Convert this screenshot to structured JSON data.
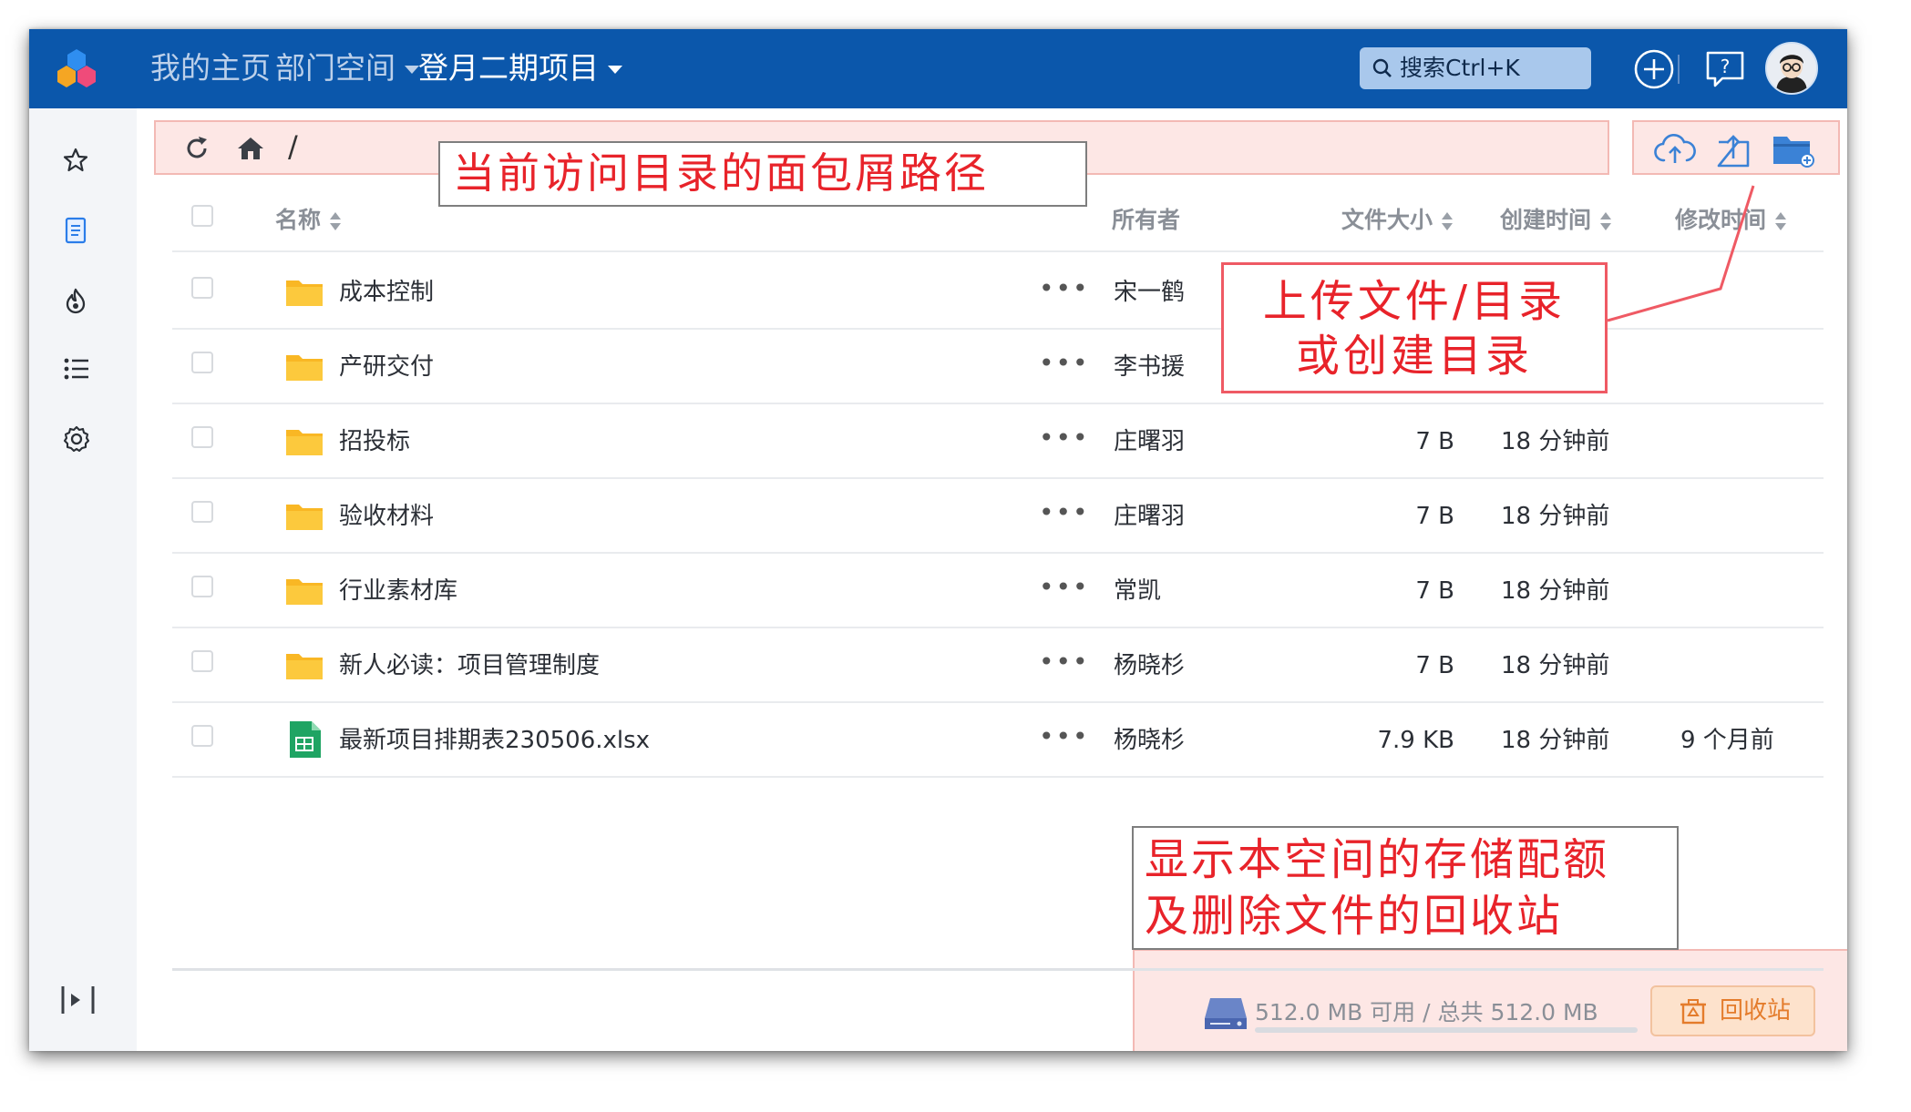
{
  "header": {
    "nav": [
      "我的主页",
      "部门空间",
      "登月二期项目"
    ],
    "search_label": "搜索Ctrl+K",
    "help_glyph": "?",
    "accent": "#0b57ab"
  },
  "breadcrumb": {
    "separator": "/"
  },
  "table": {
    "columns": {
      "name": "名称",
      "owner": "所有者",
      "size": "文件大小",
      "created": "创建时间",
      "modified": "修改时间"
    },
    "rows": [
      {
        "name": "成本控制",
        "type": "folder",
        "owner": "宋一鹤",
        "size": "",
        "created": "",
        "modified": ""
      },
      {
        "name": "产研交付",
        "type": "folder",
        "owner": "李书援",
        "size": "",
        "created": "",
        "modified": ""
      },
      {
        "name": "招投标",
        "type": "folder",
        "owner": "庄曙羽",
        "size": "7 B",
        "created": "18 分钟前",
        "modified": ""
      },
      {
        "name": "验收材料",
        "type": "folder",
        "owner": "庄曙羽",
        "size": "7 B",
        "created": "18 分钟前",
        "modified": ""
      },
      {
        "name": "行业素材库",
        "type": "folder",
        "owner": "常凯",
        "size": "7 B",
        "created": "18 分钟前",
        "modified": ""
      },
      {
        "name": "新人必读：项目管理制度",
        "type": "folder",
        "owner": "杨晓杉",
        "size": "7 B",
        "created": "18 分钟前",
        "modified": ""
      },
      {
        "name": "最新项目排期表230506.xlsx",
        "type": "spreadsheet",
        "owner": "杨晓杉",
        "size": "7.9 KB",
        "created": "18 分钟前",
        "modified": "9 个月前"
      }
    ],
    "more_glyph": "•••"
  },
  "footer": {
    "quota_text": "512.0 MB 可用 / 总共 512.0 MB",
    "recycle_label": "回收站"
  },
  "annotations": {
    "breadcrumb_note": "当前访问目录的面包屑路径",
    "upload_note_line1": "上传文件/目录",
    "upload_note_line2": "或创建目录",
    "quota_note_line1": "显示本空间的存储配额",
    "quota_note_line2": "及删除文件的回收站"
  },
  "colors": {
    "annotation_red": "#e8232a",
    "highlight_fill": "#fde7e5",
    "folder": "#fbbf24",
    "sheet": "#1fa463"
  }
}
